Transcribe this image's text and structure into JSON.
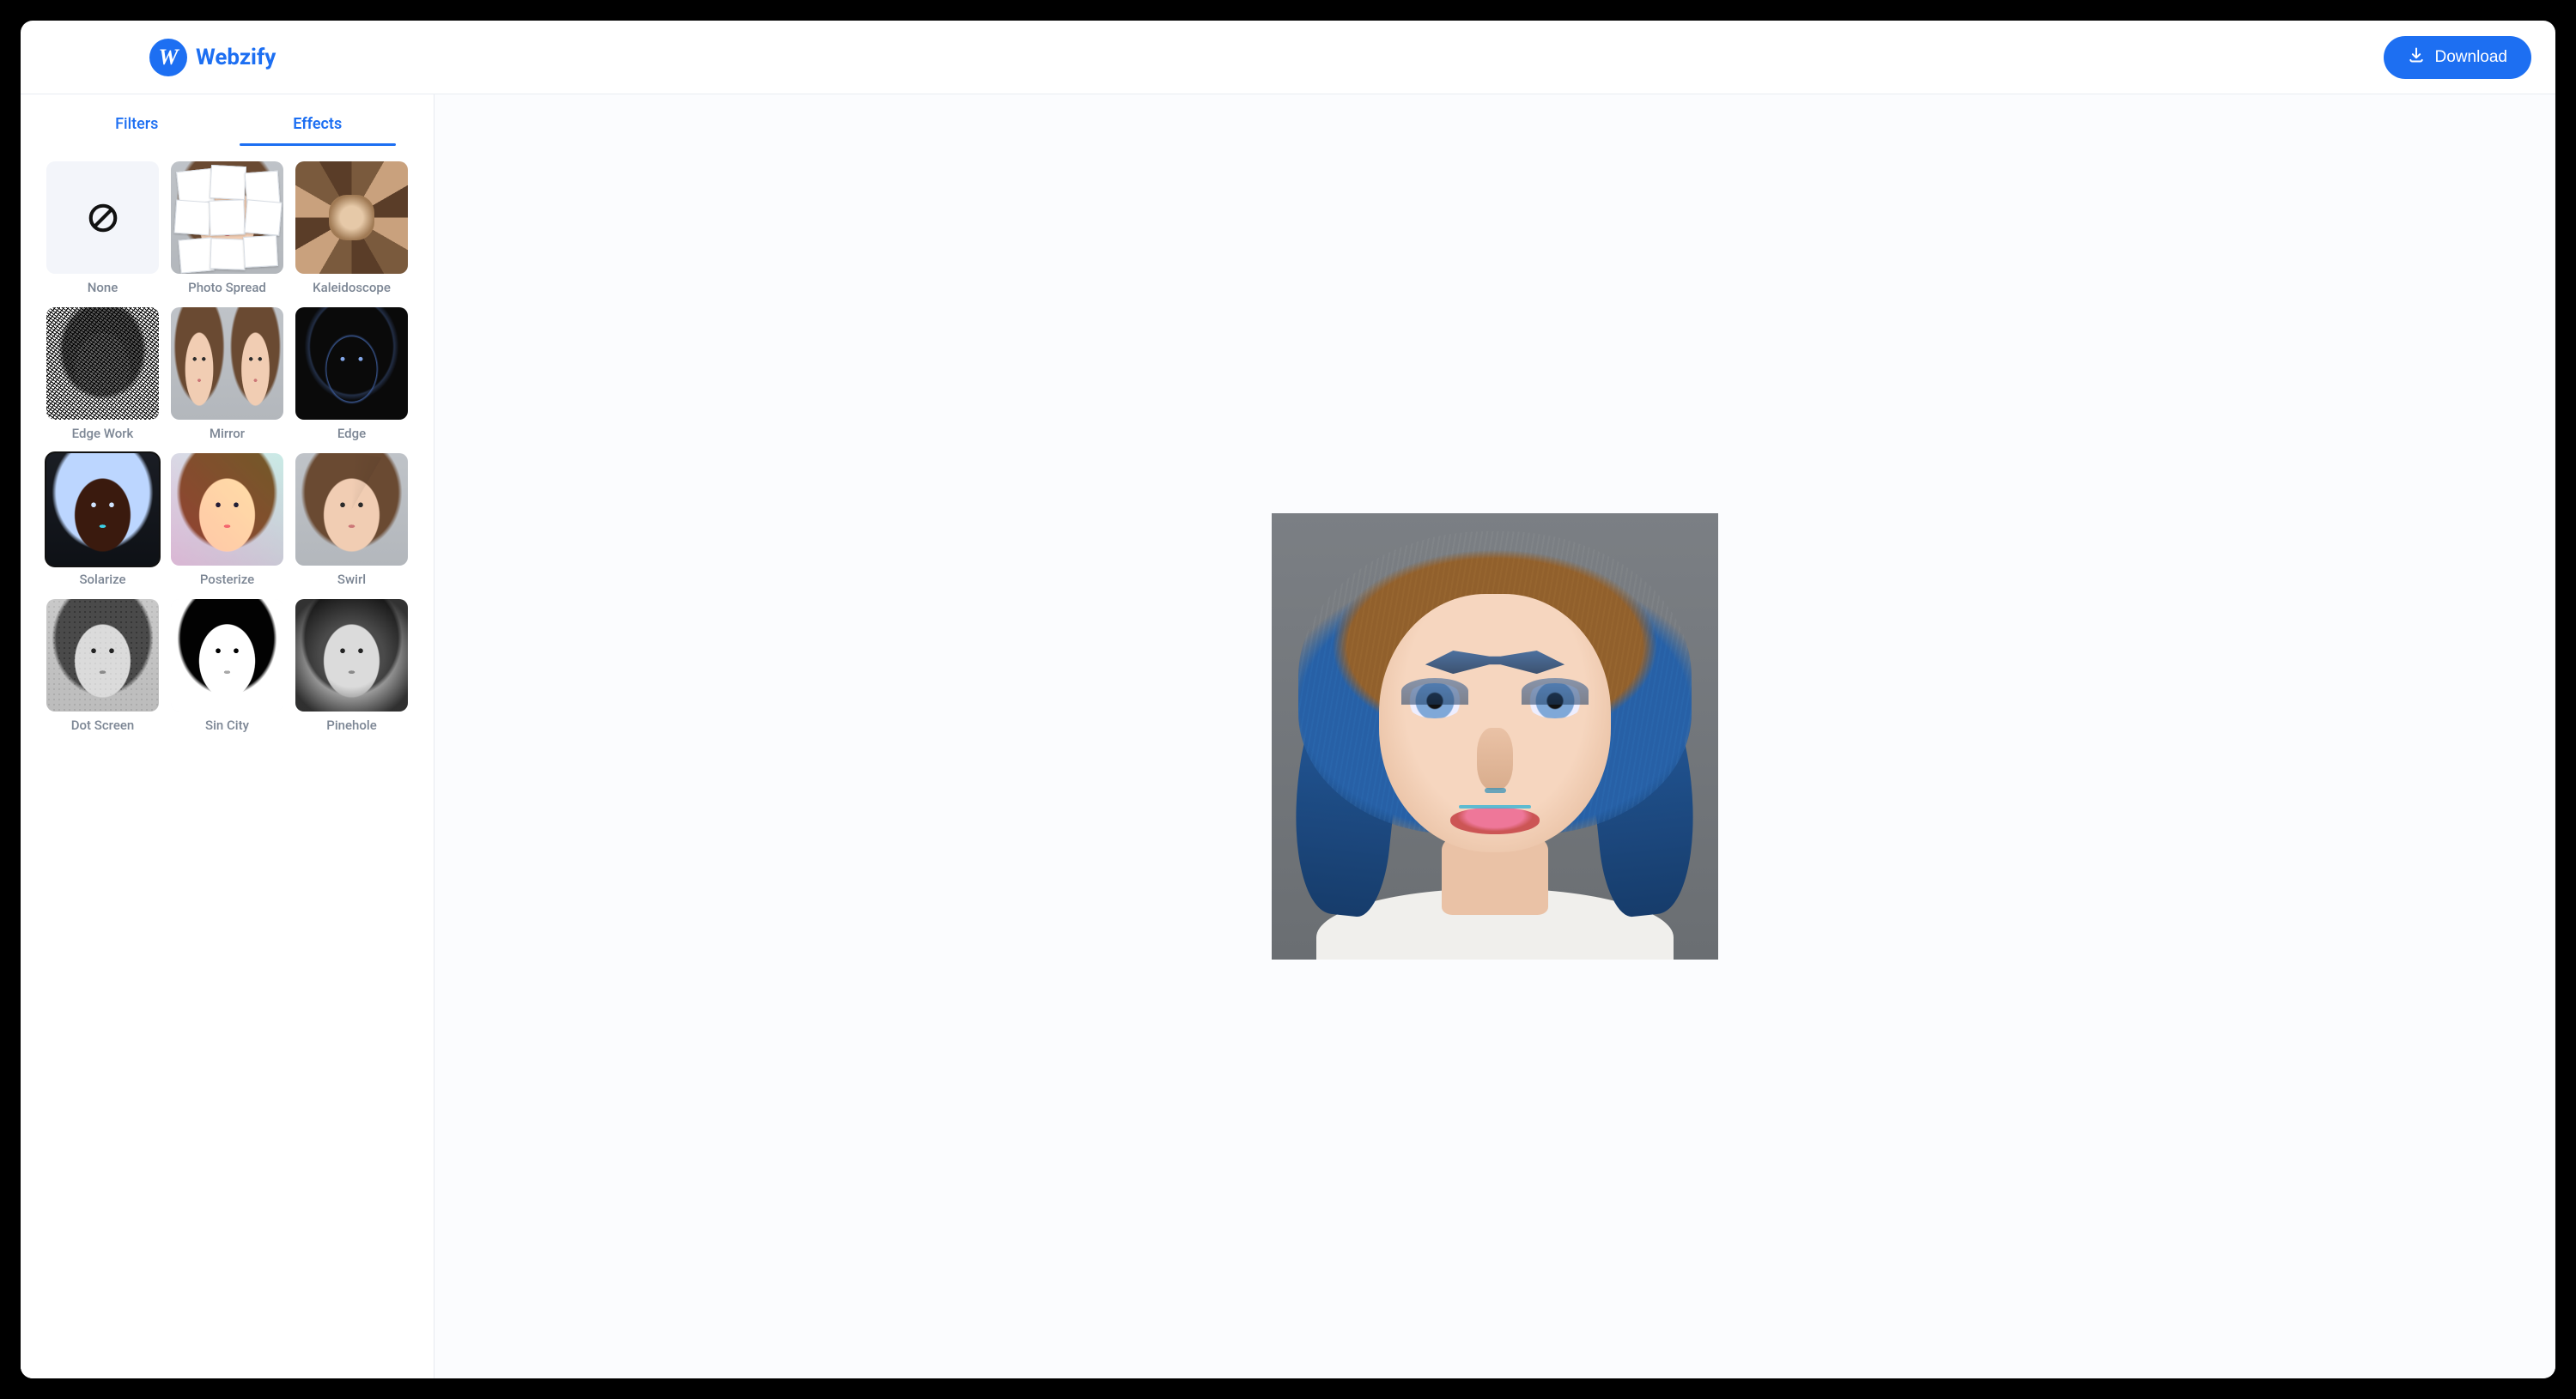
{
  "brand": {
    "logo_letter": "W",
    "name": "Webzify"
  },
  "header": {
    "download_label": "Download"
  },
  "tabs": {
    "filters": {
      "label": "Filters",
      "active": false
    },
    "effects": {
      "label": "Effects",
      "active": true
    }
  },
  "effects": [
    {
      "id": "none",
      "label": "None",
      "selected": false
    },
    {
      "id": "photo-spread",
      "label": "Photo Spread",
      "selected": false
    },
    {
      "id": "kaleidoscope",
      "label": "Kaleidoscope",
      "selected": false
    },
    {
      "id": "edge-work",
      "label": "Edge Work",
      "selected": false
    },
    {
      "id": "mirror",
      "label": "Mirror",
      "selected": false
    },
    {
      "id": "edge",
      "label": "Edge",
      "selected": false
    },
    {
      "id": "solarize",
      "label": "Solarize",
      "selected": true
    },
    {
      "id": "posterize",
      "label": "Posterize",
      "selected": false
    },
    {
      "id": "swirl",
      "label": "Swirl",
      "selected": false
    },
    {
      "id": "dot-screen",
      "label": "Dot Screen",
      "selected": false
    },
    {
      "id": "sin-city",
      "label": "Sin City",
      "selected": false
    },
    {
      "id": "pinehole",
      "label": "Pinehole",
      "selected": false
    }
  ],
  "colors": {
    "accent": "#1d6ff2"
  }
}
